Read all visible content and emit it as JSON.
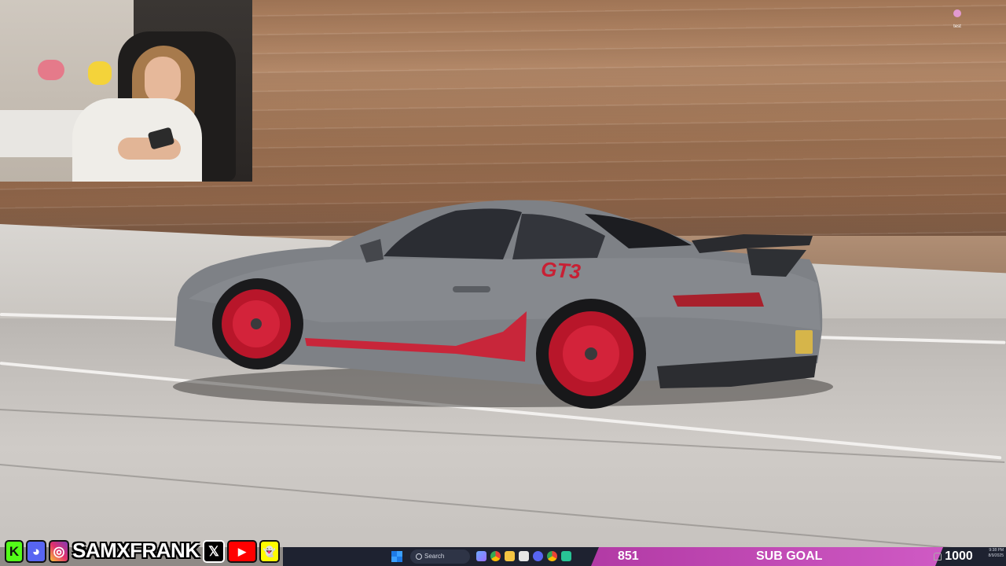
{
  "desktop_icon": {
    "label": "test",
    "icon": "file-icon"
  },
  "webcam": {
    "description_icon": "webcam-feed"
  },
  "footer": {
    "handle": "SAMXFRANK",
    "socials": [
      {
        "icon": "kick-icon",
        "glyph": "K",
        "color": "#53fc18"
      },
      {
        "icon": "discord-icon",
        "glyph": "◕",
        "color": "#5865f2"
      },
      {
        "icon": "instagram-icon",
        "glyph": "◎",
        "color": "#d6249f"
      },
      {
        "icon": "x-icon",
        "glyph": "𝕏",
        "color": "#000000"
      },
      {
        "icon": "youtube-icon",
        "glyph": "▶",
        "color": "#ff0000"
      },
      {
        "icon": "snapchat-icon",
        "glyph": "👻",
        "color": "#fffc00"
      }
    ]
  },
  "taskbar": {
    "search_placeholder": "Search",
    "apps": [
      "windows-start-icon",
      "search-icon",
      "task-view-icon",
      "chrome-icon",
      "file-explorer-icon",
      "notes-icon",
      "discord-icon",
      "chrome-icon-2",
      "app-icon"
    ]
  },
  "sub_goal": {
    "current": "851",
    "title": "SUB GOAL",
    "target": "1000",
    "bar_color": "#c24fb8"
  },
  "tray": {
    "time": "9:38 PM",
    "date": "8/9/2025"
  }
}
